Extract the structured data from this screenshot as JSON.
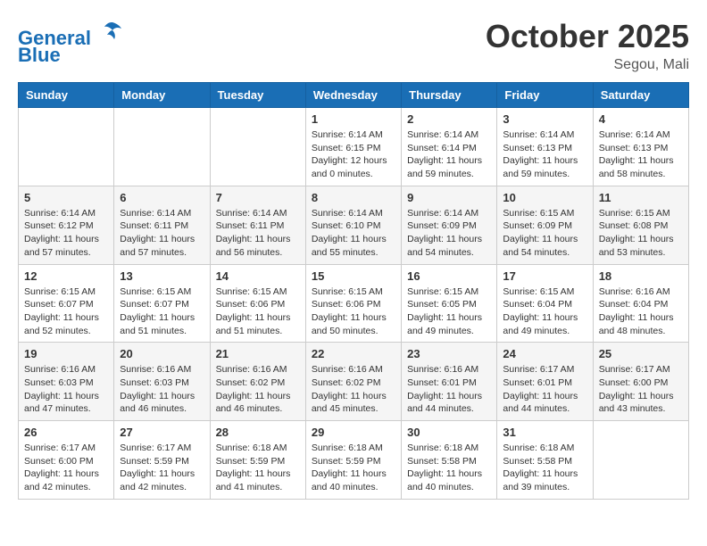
{
  "logo": {
    "line1": "General",
    "line2": "Blue"
  },
  "title": "October 2025",
  "subtitle": "Segou, Mali",
  "header_days": [
    "Sunday",
    "Monday",
    "Tuesday",
    "Wednesday",
    "Thursday",
    "Friday",
    "Saturday"
  ],
  "weeks": [
    [
      {
        "day": "",
        "info": ""
      },
      {
        "day": "",
        "info": ""
      },
      {
        "day": "",
        "info": ""
      },
      {
        "day": "1",
        "info": "Sunrise: 6:14 AM\nSunset: 6:15 PM\nDaylight: 12 hours\nand 0 minutes."
      },
      {
        "day": "2",
        "info": "Sunrise: 6:14 AM\nSunset: 6:14 PM\nDaylight: 11 hours\nand 59 minutes."
      },
      {
        "day": "3",
        "info": "Sunrise: 6:14 AM\nSunset: 6:13 PM\nDaylight: 11 hours\nand 59 minutes."
      },
      {
        "day": "4",
        "info": "Sunrise: 6:14 AM\nSunset: 6:13 PM\nDaylight: 11 hours\nand 58 minutes."
      }
    ],
    [
      {
        "day": "5",
        "info": "Sunrise: 6:14 AM\nSunset: 6:12 PM\nDaylight: 11 hours\nand 57 minutes."
      },
      {
        "day": "6",
        "info": "Sunrise: 6:14 AM\nSunset: 6:11 PM\nDaylight: 11 hours\nand 57 minutes."
      },
      {
        "day": "7",
        "info": "Sunrise: 6:14 AM\nSunset: 6:11 PM\nDaylight: 11 hours\nand 56 minutes."
      },
      {
        "day": "8",
        "info": "Sunrise: 6:14 AM\nSunset: 6:10 PM\nDaylight: 11 hours\nand 55 minutes."
      },
      {
        "day": "9",
        "info": "Sunrise: 6:14 AM\nSunset: 6:09 PM\nDaylight: 11 hours\nand 54 minutes."
      },
      {
        "day": "10",
        "info": "Sunrise: 6:15 AM\nSunset: 6:09 PM\nDaylight: 11 hours\nand 54 minutes."
      },
      {
        "day": "11",
        "info": "Sunrise: 6:15 AM\nSunset: 6:08 PM\nDaylight: 11 hours\nand 53 minutes."
      }
    ],
    [
      {
        "day": "12",
        "info": "Sunrise: 6:15 AM\nSunset: 6:07 PM\nDaylight: 11 hours\nand 52 minutes."
      },
      {
        "day": "13",
        "info": "Sunrise: 6:15 AM\nSunset: 6:07 PM\nDaylight: 11 hours\nand 51 minutes."
      },
      {
        "day": "14",
        "info": "Sunrise: 6:15 AM\nSunset: 6:06 PM\nDaylight: 11 hours\nand 51 minutes."
      },
      {
        "day": "15",
        "info": "Sunrise: 6:15 AM\nSunset: 6:06 PM\nDaylight: 11 hours\nand 50 minutes."
      },
      {
        "day": "16",
        "info": "Sunrise: 6:15 AM\nSunset: 6:05 PM\nDaylight: 11 hours\nand 49 minutes."
      },
      {
        "day": "17",
        "info": "Sunrise: 6:15 AM\nSunset: 6:04 PM\nDaylight: 11 hours\nand 49 minutes."
      },
      {
        "day": "18",
        "info": "Sunrise: 6:16 AM\nSunset: 6:04 PM\nDaylight: 11 hours\nand 48 minutes."
      }
    ],
    [
      {
        "day": "19",
        "info": "Sunrise: 6:16 AM\nSunset: 6:03 PM\nDaylight: 11 hours\nand 47 minutes."
      },
      {
        "day": "20",
        "info": "Sunrise: 6:16 AM\nSunset: 6:03 PM\nDaylight: 11 hours\nand 46 minutes."
      },
      {
        "day": "21",
        "info": "Sunrise: 6:16 AM\nSunset: 6:02 PM\nDaylight: 11 hours\nand 46 minutes."
      },
      {
        "day": "22",
        "info": "Sunrise: 6:16 AM\nSunset: 6:02 PM\nDaylight: 11 hours\nand 45 minutes."
      },
      {
        "day": "23",
        "info": "Sunrise: 6:16 AM\nSunset: 6:01 PM\nDaylight: 11 hours\nand 44 minutes."
      },
      {
        "day": "24",
        "info": "Sunrise: 6:17 AM\nSunset: 6:01 PM\nDaylight: 11 hours\nand 44 minutes."
      },
      {
        "day": "25",
        "info": "Sunrise: 6:17 AM\nSunset: 6:00 PM\nDaylight: 11 hours\nand 43 minutes."
      }
    ],
    [
      {
        "day": "26",
        "info": "Sunrise: 6:17 AM\nSunset: 6:00 PM\nDaylight: 11 hours\nand 42 minutes."
      },
      {
        "day": "27",
        "info": "Sunrise: 6:17 AM\nSunset: 5:59 PM\nDaylight: 11 hours\nand 42 minutes."
      },
      {
        "day": "28",
        "info": "Sunrise: 6:18 AM\nSunset: 5:59 PM\nDaylight: 11 hours\nand 41 minutes."
      },
      {
        "day": "29",
        "info": "Sunrise: 6:18 AM\nSunset: 5:59 PM\nDaylight: 11 hours\nand 40 minutes."
      },
      {
        "day": "30",
        "info": "Sunrise: 6:18 AM\nSunset: 5:58 PM\nDaylight: 11 hours\nand 40 minutes."
      },
      {
        "day": "31",
        "info": "Sunrise: 6:18 AM\nSunset: 5:58 PM\nDaylight: 11 hours\nand 39 minutes."
      },
      {
        "day": "",
        "info": ""
      }
    ]
  ]
}
